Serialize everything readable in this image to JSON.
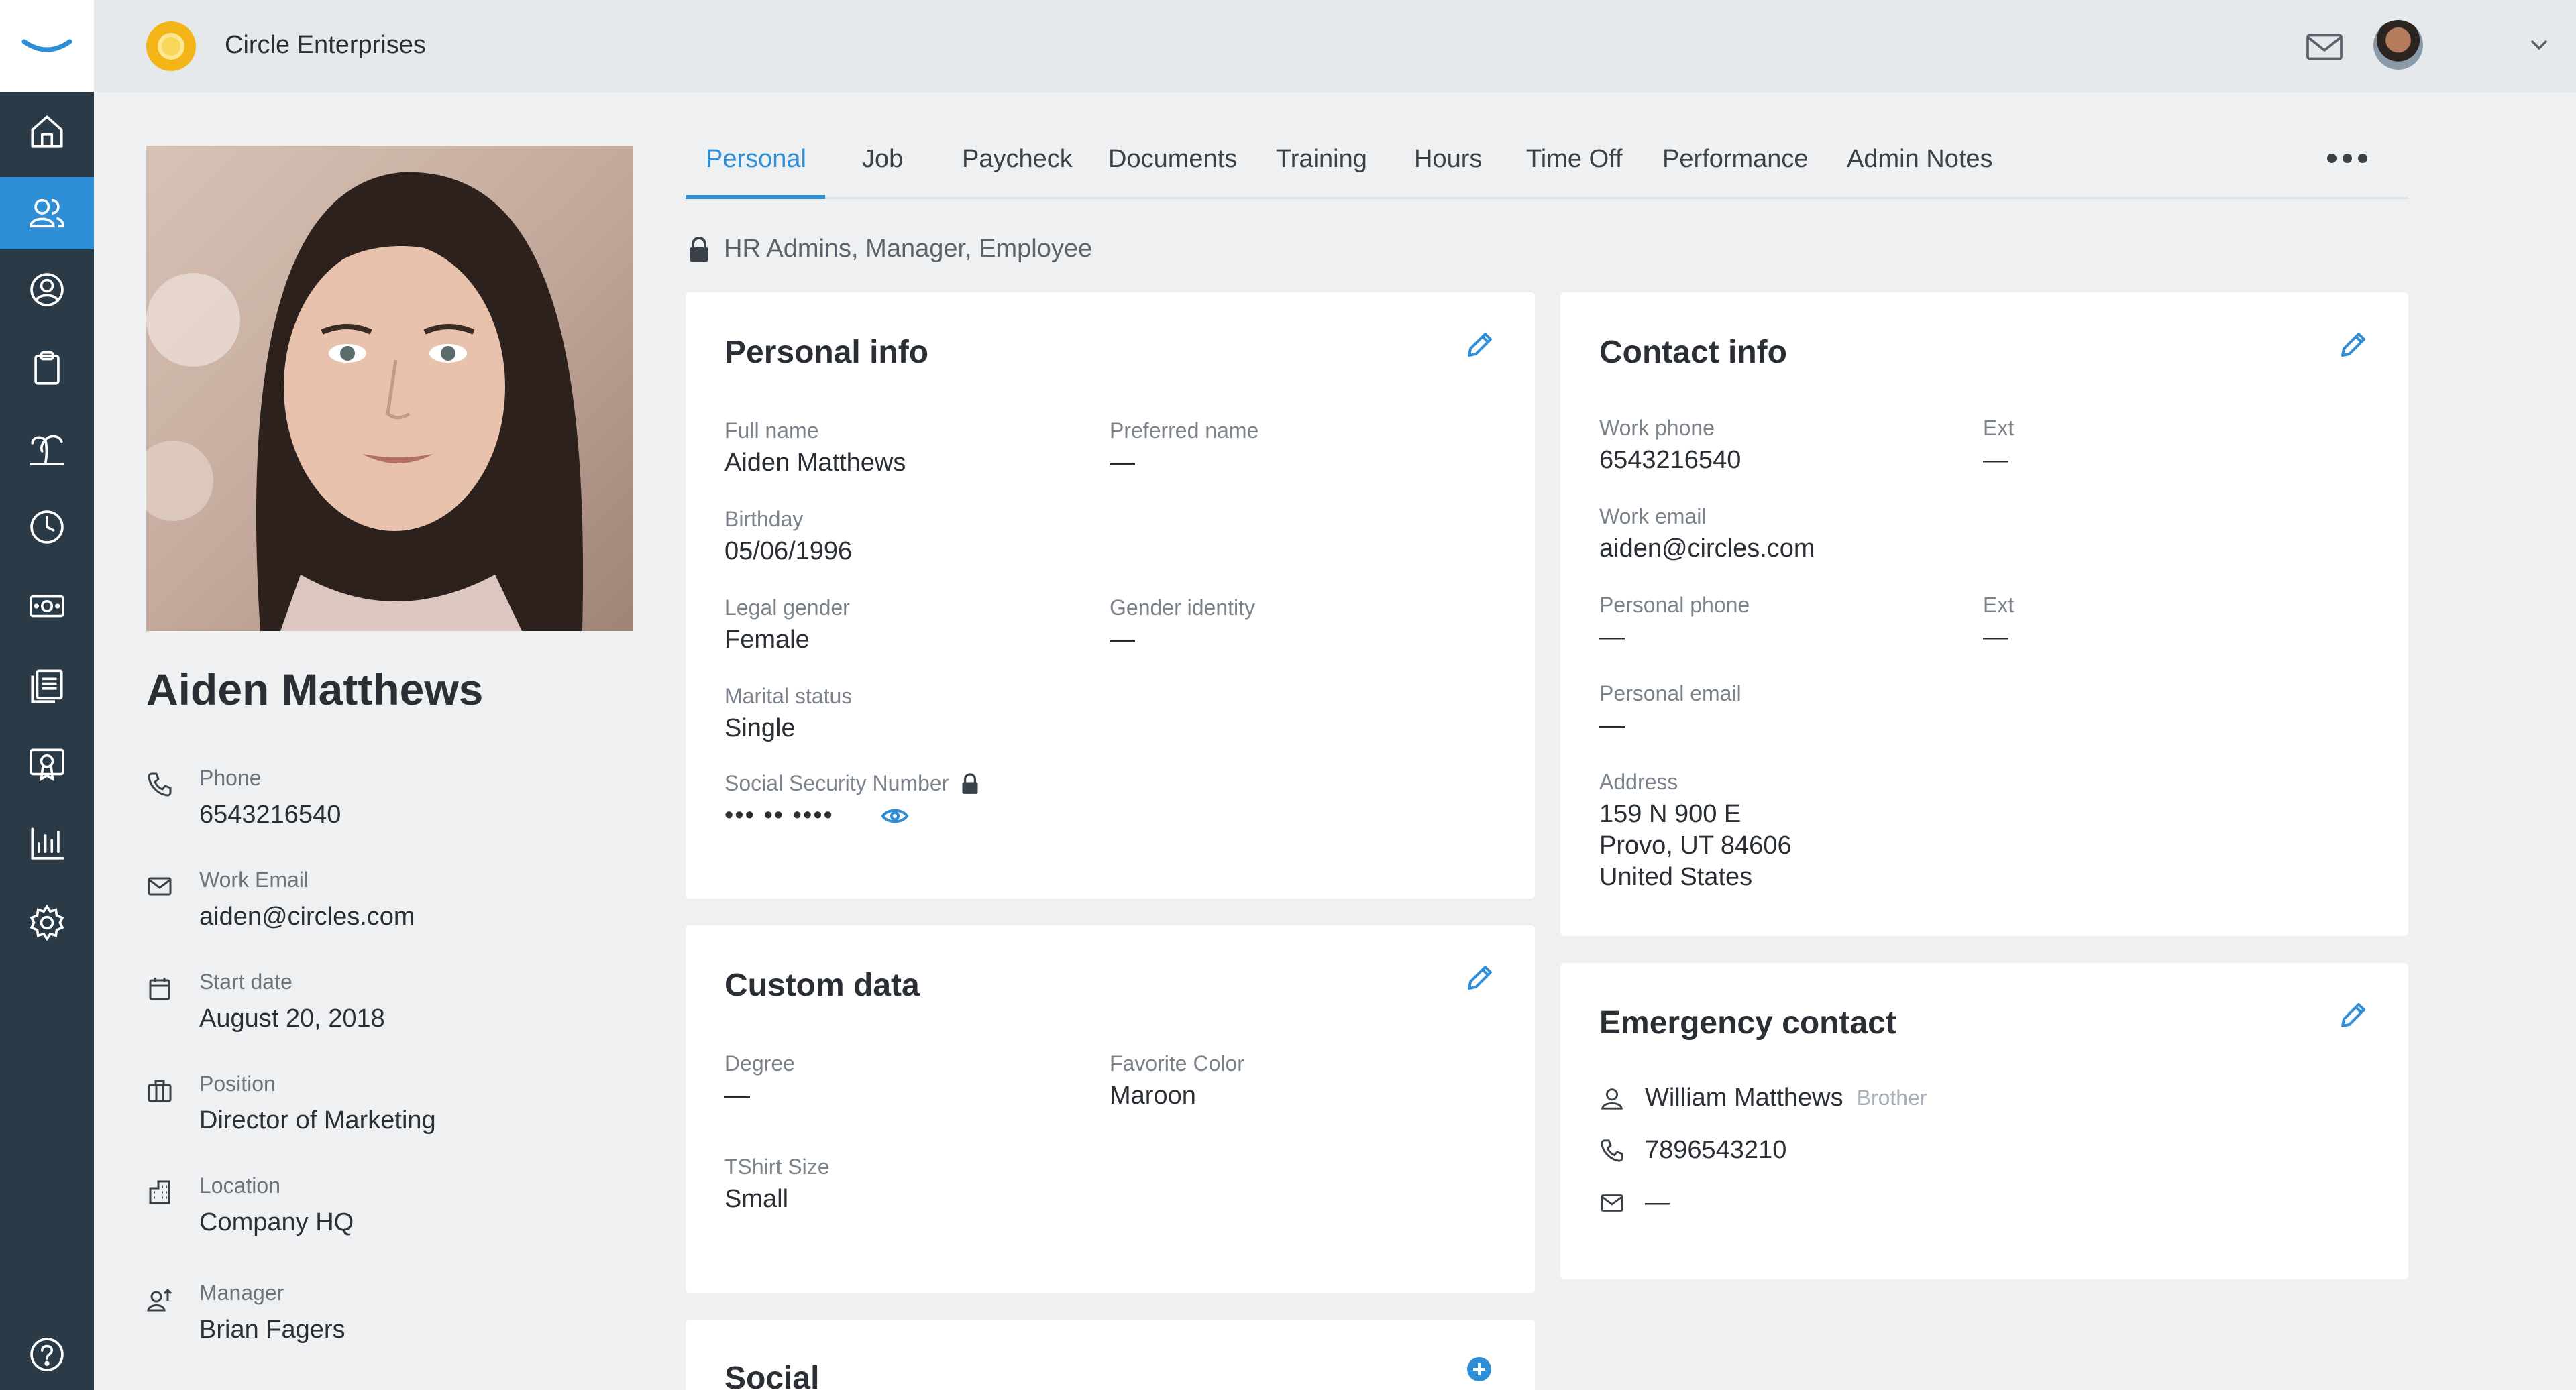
{
  "app": {
    "company_name": "Circle Enterprises",
    "accent_color": "#2f8fd6",
    "sidebar_color": "#2b3a47"
  },
  "sidebar": {
    "items": [
      {
        "icon": "home-icon",
        "active": false
      },
      {
        "icon": "people-icon",
        "active": true
      },
      {
        "icon": "person-search-icon",
        "active": false
      },
      {
        "icon": "clipboard-icon",
        "active": false
      },
      {
        "icon": "palm-tree-icon",
        "active": false
      },
      {
        "icon": "clock-icon",
        "active": false
      },
      {
        "icon": "money-icon",
        "active": false
      },
      {
        "icon": "documents-icon",
        "active": false
      },
      {
        "icon": "certificate-icon",
        "active": false
      },
      {
        "icon": "bar-chart-icon",
        "active": false
      },
      {
        "icon": "gear-icon",
        "active": false
      },
      {
        "icon": "help-icon",
        "active": false
      }
    ]
  },
  "profile": {
    "name": "Aiden Matthews",
    "fields": [
      {
        "icon": "phone-icon",
        "label": "Phone",
        "value": "6543216540"
      },
      {
        "icon": "mail-icon",
        "label": "Work Email",
        "value": "aiden@circles.com"
      },
      {
        "icon": "calendar-icon",
        "label": "Start date",
        "value": "August 20, 2018"
      },
      {
        "icon": "briefcase-icon",
        "label": "Position",
        "value": "Director of Marketing"
      },
      {
        "icon": "building-icon",
        "label": "Location",
        "value": "Company HQ"
      },
      {
        "icon": "manager-icon",
        "label": "Manager",
        "value": "Brian Fagers"
      }
    ]
  },
  "tabs": [
    "Personal",
    "Job",
    "Paycheck",
    "Documents",
    "Training",
    "Hours",
    "Time Off",
    "Performance",
    "Admin Notes"
  ],
  "access_text": "HR Admins, Manager, Employee",
  "personal_info": {
    "title": "Personal info",
    "full_name_label": "Full name",
    "full_name": "Aiden Matthews",
    "preferred_name_label": "Preferred name",
    "preferred_name": "—",
    "birthday_label": "Birthday",
    "birthday": "05/06/1996",
    "legal_gender_label": "Legal gender",
    "legal_gender": "Female",
    "gender_identity_label": "Gender identity",
    "gender_identity": "—",
    "marital_status_label": "Marital status",
    "marital_status": "Single",
    "ssn_label": "Social Security Number",
    "ssn_masked": "••• •• ••••"
  },
  "custom_data": {
    "title": "Custom data",
    "degree_label": "Degree",
    "degree": "—",
    "favorite_color_label": "Favorite Color",
    "favorite_color": "Maroon",
    "tshirt_label": "TShirt Size",
    "tshirt": "Small"
  },
  "social": {
    "title": "Social"
  },
  "contact_info": {
    "title": "Contact info",
    "work_phone_label": "Work phone",
    "work_phone": "6543216540",
    "ext_label": "Ext",
    "work_ext": "—",
    "work_email_label": "Work email",
    "work_email": "aiden@circles.com",
    "personal_phone_label": "Personal phone",
    "personal_phone": "—",
    "personal_ext": "—",
    "personal_email_label": "Personal email",
    "personal_email": "—",
    "address_label": "Address",
    "address_line1": "159 N 900 E",
    "address_line2": "Provo, UT 84606",
    "address_line3": "United States"
  },
  "emergency_contact": {
    "title": "Emergency contact",
    "name": "William Matthews",
    "relation": "Brother",
    "phone": "7896543210",
    "email": "—"
  }
}
